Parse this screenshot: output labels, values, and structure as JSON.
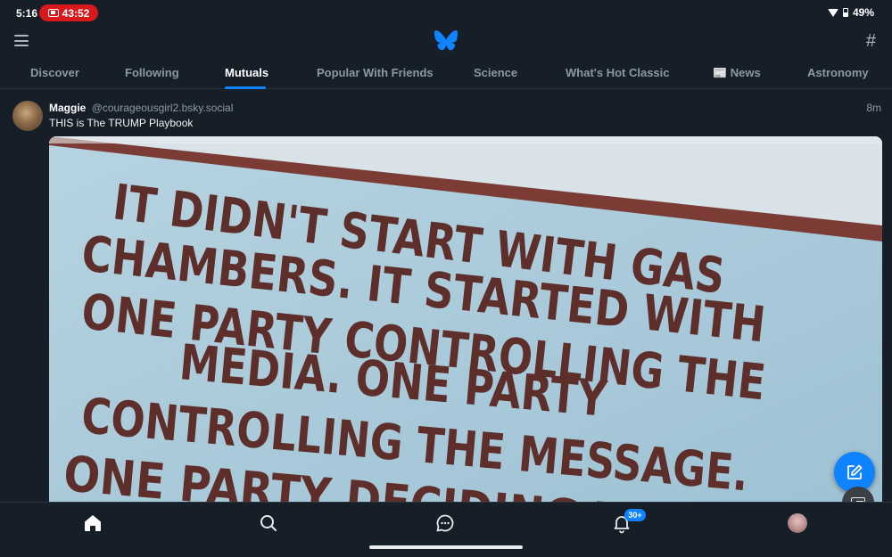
{
  "status_bar": {
    "time": "5:16",
    "recording_timer": "43:52",
    "battery": "49%"
  },
  "header": {
    "menu_icon": "menu-icon",
    "logo": "butterfly-logo",
    "feeds_icon": "hash-icon",
    "accent_color": "#1083fe"
  },
  "tabs": [
    {
      "label": "Discover"
    },
    {
      "label": "Following"
    },
    {
      "label": "Mutuals",
      "active": true
    },
    {
      "label": "Popular With Friends"
    },
    {
      "label": "Science"
    },
    {
      "label": "What's Hot Classic"
    },
    {
      "label": "📰 News"
    },
    {
      "label": "Astronomy"
    }
  ],
  "post": {
    "author_name": "Maggie",
    "author_handle": "@courageousgirl2.bsky.social",
    "time_ago": "8m",
    "text": "THIS is The TRUMP Playbook",
    "image_text_lines": [
      "IT DIDN'T START WITH GAS",
      "CHAMBERS. IT STARTED WITH",
      "ONE PARTY CONTROLLING THE",
      "MEDIA. ONE PARTY",
      "CONTROLLING THE MESSAGE.",
      "ONE PARTY DECIDING W..."
    ]
  },
  "bottom_nav": {
    "notifications_badge": "30+"
  }
}
